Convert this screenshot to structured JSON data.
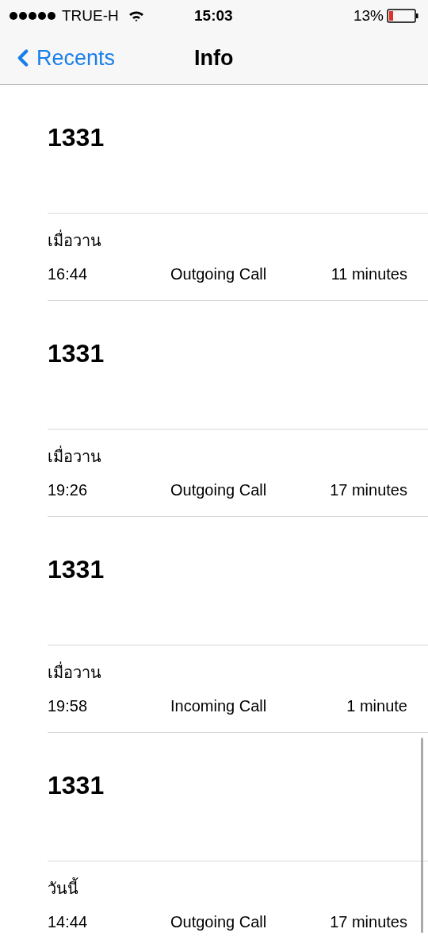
{
  "status_bar": {
    "carrier": "TRUE-H",
    "time": "15:03",
    "battery": "13%"
  },
  "nav": {
    "back": "Recents",
    "title": "Info"
  },
  "calls": [
    {
      "number": "1331",
      "date": "เมื่อวาน",
      "time": "16:44",
      "type": "Outgoing Call",
      "duration": "11 minutes"
    },
    {
      "number": "1331",
      "date": "เมื่อวาน",
      "time": "19:26",
      "type": "Outgoing Call",
      "duration": "17 minutes"
    },
    {
      "number": "1331",
      "date": "เมื่อวาน",
      "time": "19:58",
      "type": "Incoming Call",
      "duration": "1 minute"
    },
    {
      "number": "1331",
      "date": "วันนี้",
      "time": "14:44",
      "type": "Outgoing Call",
      "duration": "17 minutes"
    }
  ]
}
